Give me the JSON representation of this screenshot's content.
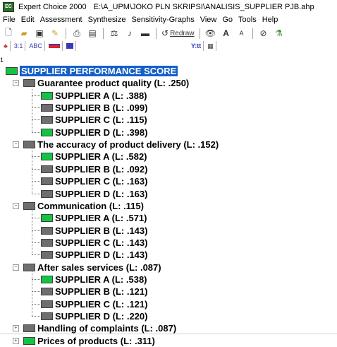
{
  "window": {
    "title": "Expert Choice 2000",
    "file_path": "E:\\A_UPM\\JOKO PLN SKRIPSI\\ANALISIS_SUPPLIER PJB.ahp"
  },
  "menu": [
    "File",
    "Edit",
    "Assessment",
    "Synthesize",
    "Sensitivity-Graphs",
    "View",
    "Go",
    "Tools",
    "Help"
  ],
  "toolbar": {
    "redraw_label": "Redraw"
  },
  "toolbar2": {
    "ratio_label": "3:1",
    "abc_label": "ABC",
    "wt_label": "Y:tt"
  },
  "tree": {
    "topline": "1",
    "goal": "SUPPLIER PERFORMANCE SCORE",
    "criteria": [
      {
        "label": "Guarantee product quality (L: .250)",
        "children": [
          "SUPPLIER A (L: .388)",
          "SUPPLIER B (L: .099)",
          "SUPPLIER C (L: .115)",
          "SUPPLIER D (L: .398)"
        ]
      },
      {
        "label": "The accuracy of product delivery (L: .152)",
        "children": [
          "SUPPLIER A (L: .582)",
          "SUPPLIER B (L: .092)",
          "SUPPLIER C (L: .163)",
          "SUPPLIER D (L: .163)"
        ]
      },
      {
        "label": "Communication (L: .115)",
        "children": [
          "SUPPLIER A (L: .571)",
          "SUPPLIER B (L: .143)",
          "SUPPLIER C (L: .143)",
          "SUPPLIER D (L: .143)"
        ]
      },
      {
        "label": "After sales services (L: .087)",
        "children": [
          "SUPPLIER A (L: .538)",
          "SUPPLIER B (L: .121)",
          "SUPPLIER C (L: .121)",
          "SUPPLIER D (L: .220)"
        ]
      },
      {
        "label": "Handling of complaints (L: .087)",
        "children": []
      },
      {
        "label": "Prices of products (L: .311)",
        "children": []
      }
    ]
  },
  "colors": {
    "node_green": "#12c442",
    "node_gray": "#6e6e6e",
    "goal_highlight": "#1460c8"
  }
}
